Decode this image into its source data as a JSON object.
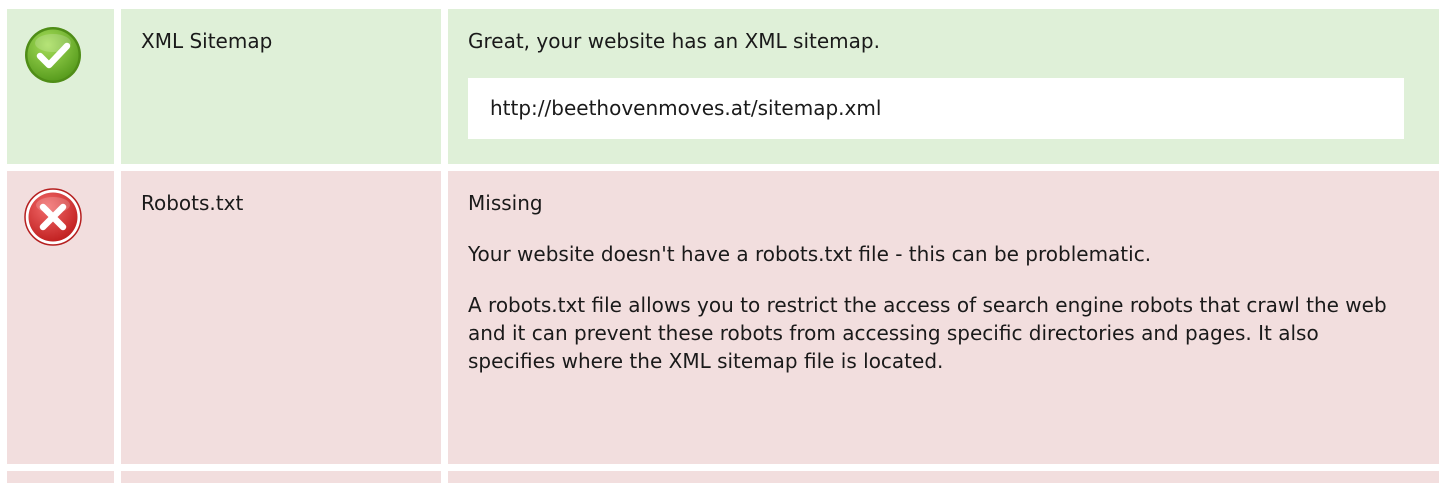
{
  "rows": [
    {
      "status": "pass",
      "status_icon": "check-circle-icon",
      "status_color": "#6fae2f",
      "name": "XML Sitemap",
      "message": "Great, your website has an XML sitemap.",
      "url": "http://beethovenmoves.at/sitemap.xml"
    },
    {
      "status": "fail",
      "status_icon": "x-circle-icon",
      "status_color": "#d62f2f",
      "name": "Robots.txt",
      "message": "Missing",
      "paragraphs": [
        "Your website doesn't have a robots.txt file - this can be problematic.",
        "A robots.txt file allows you to restrict the access of search engine robots that crawl the web and it can prevent these robots from accessing specific directories and pages. It also specifies where the XML sitemap file is located."
      ]
    }
  ],
  "colors": {
    "pass_bg": "#dff0d8",
    "fail_bg": "#f2dede",
    "url_box_bg": "#ffffff"
  }
}
